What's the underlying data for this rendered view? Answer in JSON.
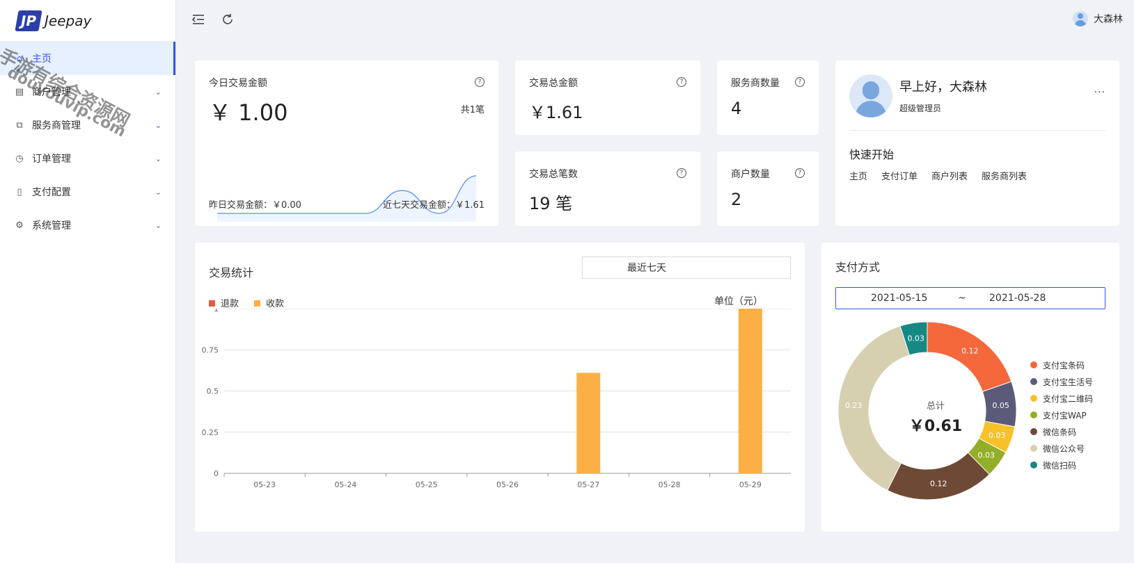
{
  "app": {
    "logo_mark": "JP",
    "logo_text": "Jeepay"
  },
  "sidebar": {
    "items": [
      {
        "label": "主页",
        "icon": "home-icon",
        "active": true
      },
      {
        "label": "商户管理",
        "icon": "store-icon",
        "active": false
      },
      {
        "label": "服务商管理",
        "icon": "partner-icon",
        "active": false
      },
      {
        "label": "订单管理",
        "icon": "order-icon",
        "active": false
      },
      {
        "label": "支付配置",
        "icon": "pay-config-icon",
        "active": false
      },
      {
        "label": "系统管理",
        "icon": "gear-icon",
        "active": false
      }
    ]
  },
  "header": {
    "user_name": "大森林"
  },
  "today": {
    "title": "今日交易金额",
    "amount": "￥ 1.00",
    "count": "共1笔",
    "yesterday": "昨日交易金额：￥0.00",
    "seven_days": "近七天交易金额：￥1.61",
    "sparkline": [
      0,
      0,
      0,
      0,
      0,
      0.61,
      0,
      1
    ]
  },
  "stats": {
    "total_amount": {
      "title": "交易总金额",
      "value": "￥1.61"
    },
    "total_count": {
      "title": "交易总笔数",
      "value": "19 笔"
    },
    "isv_count": {
      "title": "服务商数量",
      "value": "4"
    },
    "mch_count": {
      "title": "商户数量",
      "value": "2"
    }
  },
  "welcome": {
    "greeting": "早上好，大森林",
    "role": "超级管理员",
    "more": "···",
    "quick_title": "快速开始",
    "links": [
      "主页",
      "支付订单",
      "商户列表",
      "服务商列表"
    ]
  },
  "trade": {
    "title": "交易统计",
    "range": "最近七天",
    "unit": "单位（元）",
    "legend": [
      "退款",
      "收款"
    ]
  },
  "pay": {
    "title": "支付方式",
    "date_from": "2021-05-15",
    "date_sep": "~",
    "date_to": "2021-05-28",
    "total_label": "总计",
    "total_value": "￥0.61"
  },
  "colors": {
    "refund": "#e05a47",
    "income": "#fbaf45",
    "accent": "#2f54eb"
  },
  "watermark": {
    "line1": "手游有综合资源网",
    "line2": "douyouvip.com"
  },
  "chart_data": [
    {
      "type": "bar",
      "categories": [
        "05-23",
        "05-24",
        "05-25",
        "05-26",
        "05-27",
        "05-28",
        "05-29"
      ],
      "series": [
        {
          "name": "退款",
          "values": [
            0,
            0,
            0,
            0,
            0,
            0,
            0
          ]
        },
        {
          "name": "收款",
          "values": [
            0,
            0,
            0,
            0,
            0.61,
            0,
            1
          ]
        }
      ],
      "ylim": [
        0,
        1
      ],
      "yticks": [
        "0",
        "0.25",
        "0.5",
        "0.75",
        "1"
      ],
      "grid": true,
      "legend": "top-left"
    },
    {
      "type": "pie",
      "labels": [
        "支付宝条码",
        "支付宝生活号",
        "支付宝二维码",
        "支付宝WAP",
        "微信条码",
        "微信公众号",
        "微信扫码"
      ],
      "values": [
        0.12,
        0.05,
        0.03,
        0.03,
        0.12,
        0.23,
        0.03
      ],
      "colors": [
        "#f4683c",
        "#5b5a78",
        "#f7c12a",
        "#93ae28",
        "#6e4a36",
        "#d6d0b0",
        "#178984"
      ],
      "legend": "right"
    }
  ]
}
